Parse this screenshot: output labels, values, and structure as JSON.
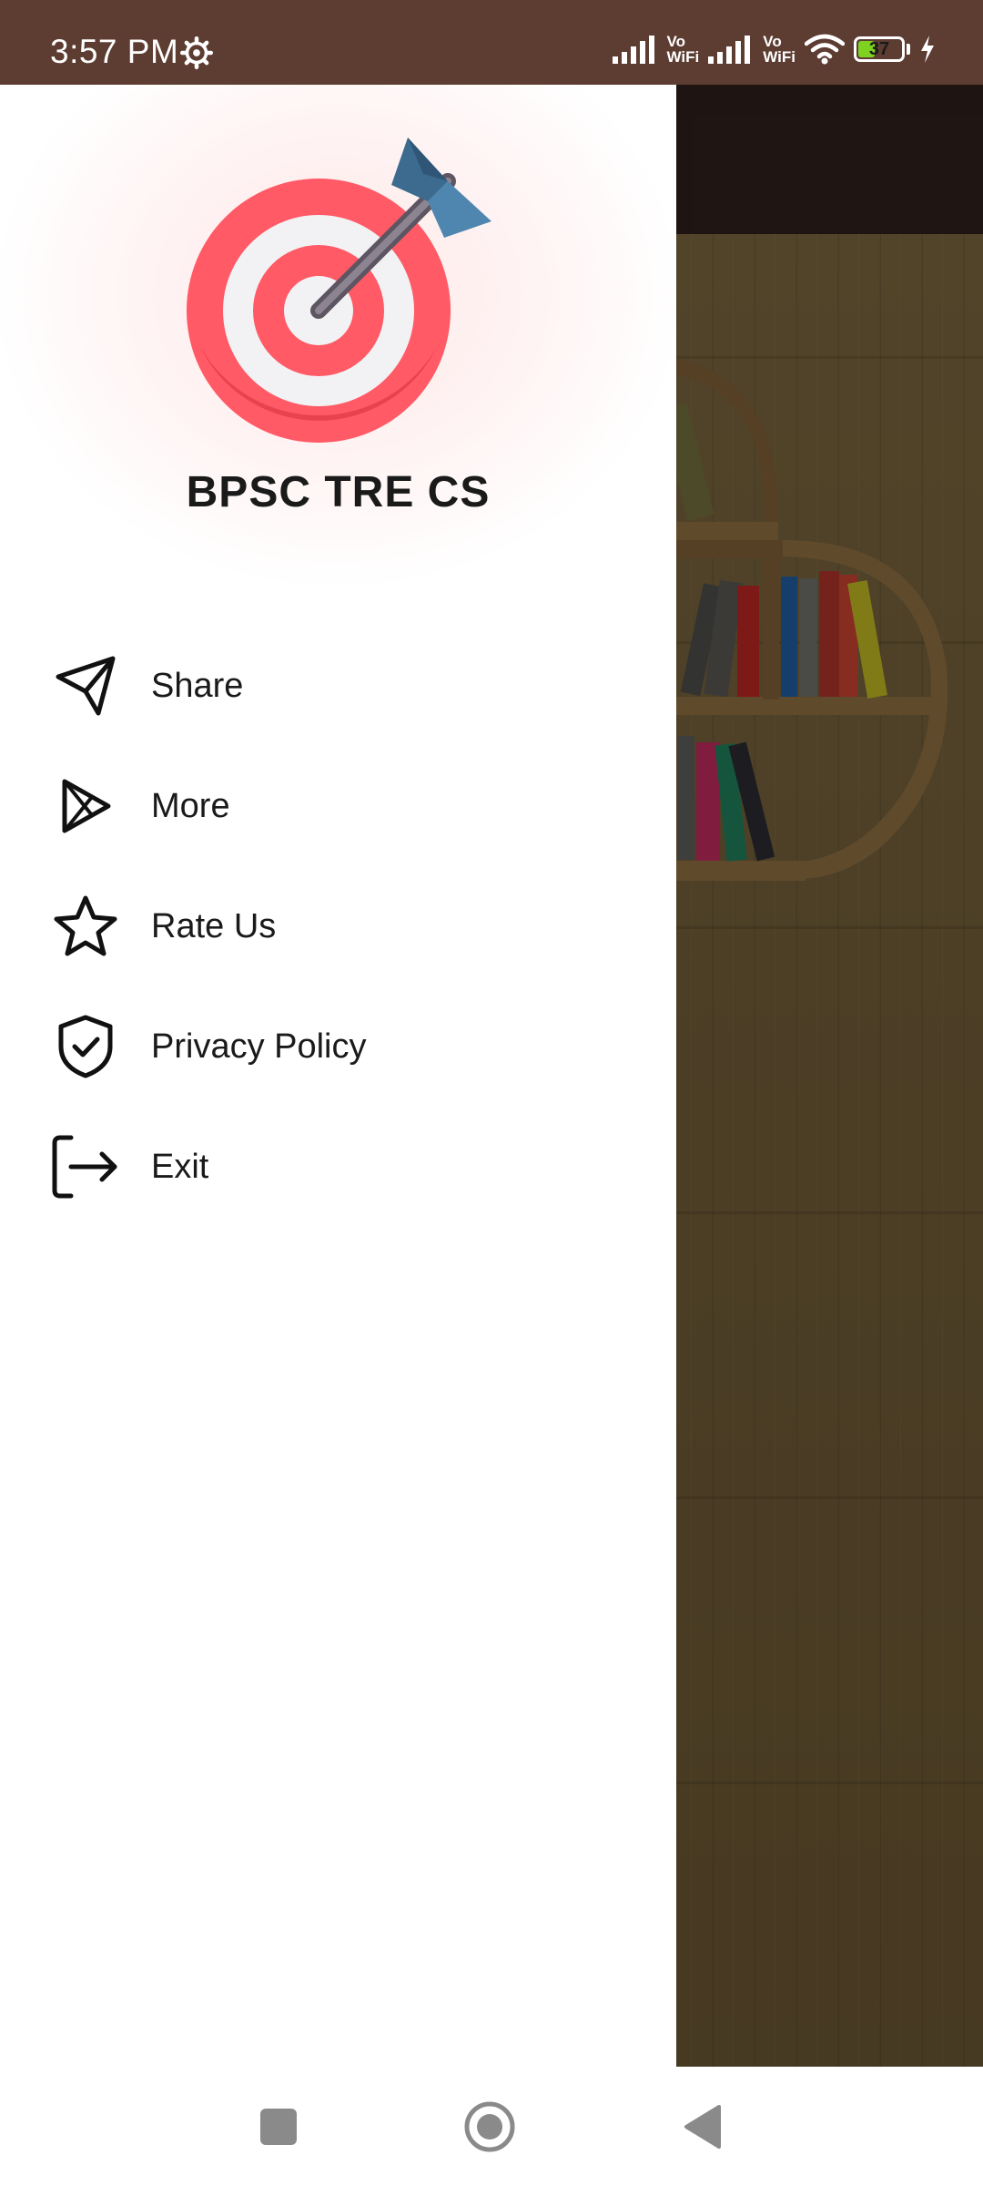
{
  "status_bar": {
    "time": "3:57 PM",
    "icons": [
      "settings-gear-icon",
      "signal-icon",
      "vowifi-icon",
      "signal-icon",
      "vowifi-icon",
      "wifi-icon",
      "battery-icon",
      "charging-icon"
    ],
    "vowifi_label_top": "Vo",
    "vowifi_label_bottom": "WiFi",
    "battery_level": "37"
  },
  "drawer": {
    "app_title": "BPSC TRE CS",
    "logo_icon": "target-with-arrow-icon",
    "menu": [
      {
        "label": "Share",
        "icon": "paper-plane-icon"
      },
      {
        "label": "More",
        "icon": "play-store-icon"
      },
      {
        "label": "Rate Us",
        "icon": "star-icon"
      },
      {
        "label": "Privacy Policy",
        "icon": "shield-check-icon"
      },
      {
        "label": "Exit",
        "icon": "exit-icon"
      }
    ]
  },
  "colors": {
    "status_bar": "#5d3c32",
    "app_toolbar": "#2c1f1b",
    "wood": "#6e5b37",
    "target_red": "#ff5a66",
    "arrow_blue": "#3d6b8f"
  },
  "nav_bar": {
    "buttons": [
      "recents-square-icon",
      "home-circle-icon",
      "back-triangle-icon"
    ]
  }
}
